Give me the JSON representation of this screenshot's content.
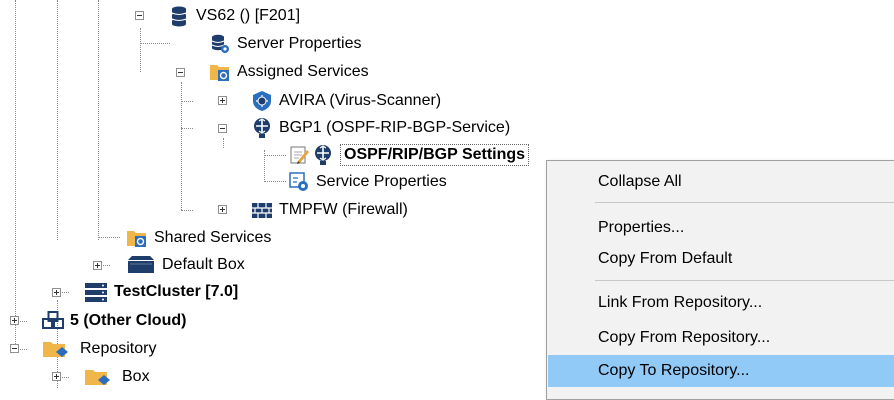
{
  "tree": {
    "vs62": {
      "label": "VS62 () [F201]",
      "icon": "database-stack-icon"
    },
    "server_properties": {
      "label": "Server Properties",
      "icon": "database-gear-icon"
    },
    "assigned_services": {
      "label": "Assigned Services",
      "icon": "folder-service-icon"
    },
    "avira": {
      "label": "AVIRA (Virus-Scanner)",
      "icon": "virus-scanner-icon"
    },
    "bgp1": {
      "label": "BGP1 (OSPF-RIP-BGP-Service)",
      "icon": "router-icon"
    },
    "ospf_settings": {
      "label": "OSPF/RIP/BGP Settings",
      "icon": "edit-router-icon"
    },
    "service_properties": {
      "label": "Service Properties",
      "icon": "properties-gear-icon"
    },
    "tmpfw": {
      "label": "TMPFW (Firewall)",
      "icon": "firewall-icon"
    },
    "shared_services": {
      "label": "Shared Services",
      "icon": "folder-service-icon"
    },
    "default_box": {
      "label": "Default Box",
      "icon": "box-icon"
    },
    "testcluster": {
      "label": "TestCluster [7.0]",
      "icon": "server-rack-icon"
    },
    "other_cloud": {
      "label": "5 (Other Cloud)",
      "icon": "cloud-nodes-icon"
    },
    "repository": {
      "label": "Repository",
      "icon": "folder-repository-icon"
    },
    "box": {
      "label": "Box",
      "icon": "folder-repository-icon"
    }
  },
  "context_menu": {
    "collapse_all": "Collapse All",
    "properties": "Properties...",
    "copy_from_default": "Copy From Default",
    "link_from_repository": "Link From Repository...",
    "copy_from_repository": "Copy From Repository...",
    "copy_to_repository": "Copy To Repository..."
  },
  "colors": {
    "menu_highlight": "#91c9f7",
    "menu_background": "#f2f2f2",
    "folder": "#f0b64a",
    "icon_blue": "#2a6ebd",
    "icon_navy": "#1f3d6b"
  }
}
